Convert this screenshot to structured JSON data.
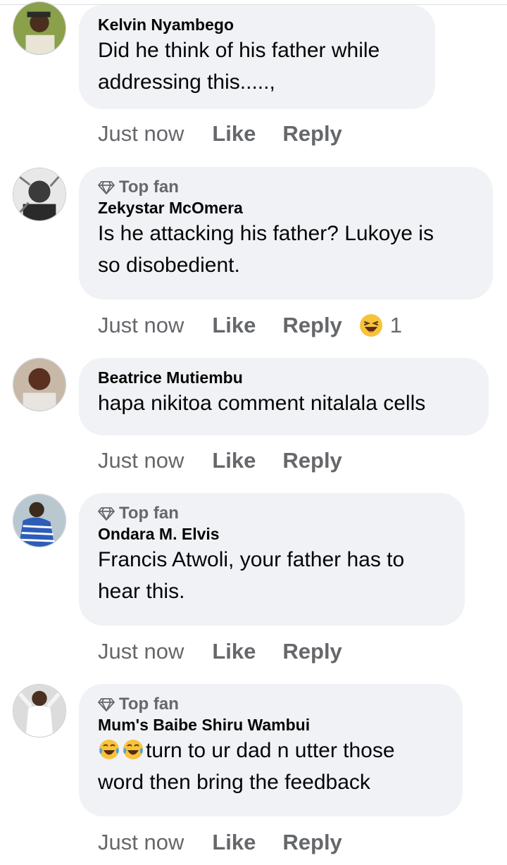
{
  "comments": [
    {
      "author": "Kelvin Nyambego",
      "top_fan": false,
      "text_lines": [
        "Did he think of his father while",
        "addressing this.....,"
      ],
      "time": "Just now",
      "like": "Like",
      "reply": "Reply"
    },
    {
      "author": "Zekystar McOmera",
      "top_fan": true,
      "top_fan_label": "Top fan",
      "text_lines": [
        "Is he attacking his father? Lukoye is",
        "so disobedient."
      ],
      "time": "Just now",
      "like": "Like",
      "reply": "Reply",
      "reaction": {
        "icon": "haha-emoji-icon",
        "count": "1"
      }
    },
    {
      "author": "Beatrice Mutiembu",
      "top_fan": false,
      "text_lines": [
        "hapa nikitoa comment nitalala cells"
      ],
      "time": "Just now",
      "like": "Like",
      "reply": "Reply"
    },
    {
      "author": "Ondara M. Elvis",
      "top_fan": true,
      "top_fan_label": "Top fan",
      "text_lines": [
        "Francis Atwoli, your father has to",
        "hear this."
      ],
      "time": "Just now",
      "like": "Like",
      "reply": "Reply"
    },
    {
      "author": "Mum's Baibe Shiru Wambui",
      "top_fan": true,
      "top_fan_label": "Top fan",
      "text_lines": [
        "turn to ur dad n utter those",
        "word then bring the feedback"
      ],
      "text_prefix_icons": [
        "tears-of-joy-emoji-icon",
        "tears-of-joy-emoji-icon"
      ],
      "time": "Just now",
      "like": "Like",
      "reply": "Reply"
    }
  ],
  "colors": {
    "bubble": "#f0f2f5",
    "secondary_text": "#65676b",
    "primary_text": "#050505"
  }
}
